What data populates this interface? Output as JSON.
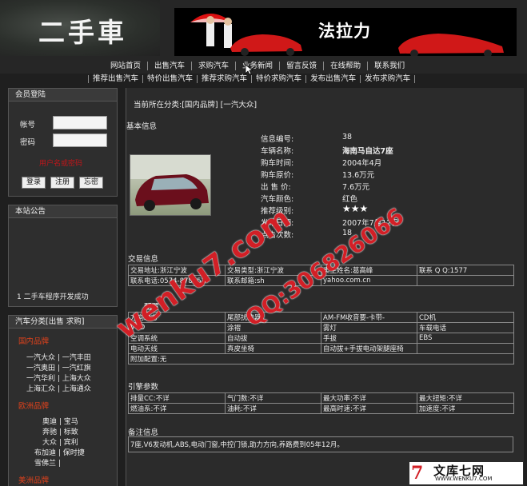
{
  "header": {
    "logo": "二手車",
    "banner_title": "法拉力"
  },
  "main_nav": [
    "网站首页",
    "出售汽车",
    "求购汽车",
    "业务新闻",
    "留言反馈",
    "在线帮助",
    "联系我们"
  ],
  "sub_nav": [
    "推荐出售汽车",
    "特价出售汽车",
    "推荐求购汽车",
    "特价求购汽车",
    "发布出售汽车",
    "发布求购汽车"
  ],
  "login": {
    "title": "会员登陆",
    "account_label": "帐号",
    "password_label": "密码",
    "error_text": "用户名或密码",
    "login_button": "登录",
    "register_button": "注册",
    "forgot_button": "忘密"
  },
  "notice": {
    "title": "本站公告",
    "item": "1 二手车程序开发成功"
  },
  "categories": {
    "title": "汽车分类[出售 求购]",
    "groups": [
      {
        "name": "国内品牌",
        "rows": [
          "一汽大众 | 一汽丰田",
          "一汽奥田 | 一汽红旗",
          "一汽华利 | 上海大众",
          "上海汇众 | 上海通众"
        ]
      },
      {
        "name": "欧洲品牌",
        "rows": [
          "奥迪 | 宝马",
          "奔驰 | 标致",
          "大众 | 宾利",
          "布加迪 | 保时捷",
          "雪佛兰 |"
        ]
      },
      {
        "name": "美洲品牌",
        "rows": []
      }
    ]
  },
  "breadcrumb": "当前所在分类:[国内品牌] [一汽大众]",
  "basic_info": {
    "title": "基本信息",
    "fields": [
      {
        "label": "信息编号:",
        "value": "38"
      },
      {
        "label": "车辆名称:",
        "value": "海南马自达7座"
      },
      {
        "label": "购车时间:",
        "value": "2004年4月"
      },
      {
        "label": "购车原价:",
        "value": "13.6万元"
      },
      {
        "label": "出 售 价:",
        "value": "7.6万元"
      },
      {
        "label": "汽车颜色:",
        "value": "红色"
      },
      {
        "label": "推荐级别:",
        "value": "★★★"
      },
      {
        "label": "发布日期:",
        "value": "2007年7月12日"
      },
      {
        "label": "点击次数:",
        "value": "18"
      }
    ]
  },
  "trade_info": {
    "title": "交易信息",
    "rows": [
      [
        "交易地址:浙江宁波",
        "交易类型:浙江宁波",
        "卖主姓名:葛高峰",
        "联系 Q Q:1577"
      ],
      [
        "联系电话:0574-878352",
        "联系邮箱:sh",
        "yahoo.com.cn",
        ""
      ]
    ]
  },
  "config": {
    "title": "配置",
    "rows": [
      [
        "方向助力",
        "尾部扰流器",
        "AM-FM收音要-卡带-",
        "CD机"
      ],
      [
        "VCD",
        "涂褶",
        "雾灯",
        "车载电话"
      ],
      [
        "空调系统",
        "自动拔",
        "手拔",
        "EBS"
      ],
      [
        "电动天线",
        "真皮坐椅",
        "自动拔+手拔电动架腿座椅",
        ""
      ],
      [
        "附加配置:无",
        "",
        "",
        ""
      ]
    ]
  },
  "engine": {
    "title": "引擎参数",
    "rows": [
      [
        "排量CC:不详",
        "气门数:不详",
        "最大功率:不详",
        "最大扭矩:不详"
      ],
      [
        "燃油系:不详",
        "油耗:不详",
        "最高时速:不详",
        "加速度:不详"
      ]
    ]
  },
  "remarks": {
    "title": "备注信息",
    "text": "7座,V6发动机,ABS,电动门窗,中控门锁,助力方向,养路费到05年12月。"
  },
  "watermark": {
    "site": "wenku7.com",
    "qq": "QQ:306826066",
    "footer_main": "文库七网",
    "footer_sub": "WWW.WENKU7.COM",
    "color": "#d21f26"
  },
  "colors": {
    "background": "#1f1f1f",
    "category_title": "#e0421c",
    "error": "#c0161a"
  }
}
